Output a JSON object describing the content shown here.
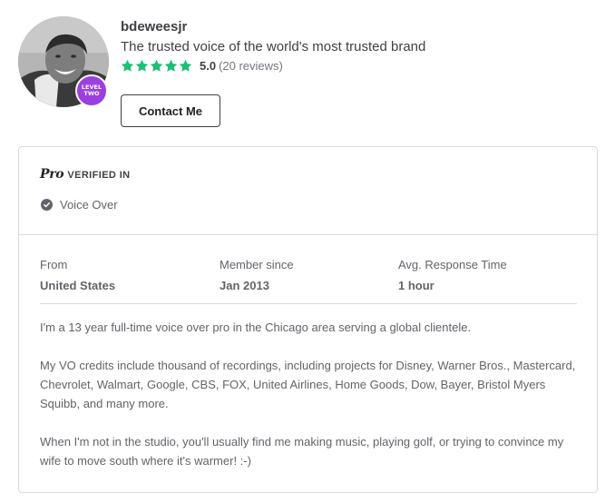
{
  "seller": {
    "username": "bdeweesjr",
    "tagline": "The trusted voice of the world's most trusted brand",
    "level_badge": [
      "LEVEL",
      "TWO"
    ],
    "rating": {
      "score": "5.0",
      "count_text": "(20 reviews)",
      "stars": 5,
      "star_color": "#1dbf73"
    },
    "contact_label": "Contact Me"
  },
  "pro": {
    "logo": "Pro",
    "verified_label": "VERIFIED IN",
    "skills": [
      "Voice Over"
    ]
  },
  "stats": [
    {
      "label": "From",
      "value": "United States"
    },
    {
      "label": "Member since",
      "value": "Jan 2013"
    },
    {
      "label": "Avg. Response Time",
      "value": "1 hour"
    }
  ],
  "description": [
    "I'm a 13 year full-time voice over pro in the Chicago area serving a global clientele.",
    "My VO credits include thousand of recordings, including projects for Disney, Warner Bros., Mastercard, Chevrolet, Walmart, Google, CBS, FOX, United Airlines, Home Goods, Dow, Bayer, Bristol Myers Squibb, and many more.",
    "When I'm not in the studio, you'll usually find me making music, playing golf, or trying to convince my wife to move south where it's warmer! :-)"
  ],
  "colors": {
    "badge": "#9c3fe0",
    "star": "#1dbf73",
    "text": "#404145",
    "muted": "#62646a",
    "border": "#dadbdd"
  }
}
